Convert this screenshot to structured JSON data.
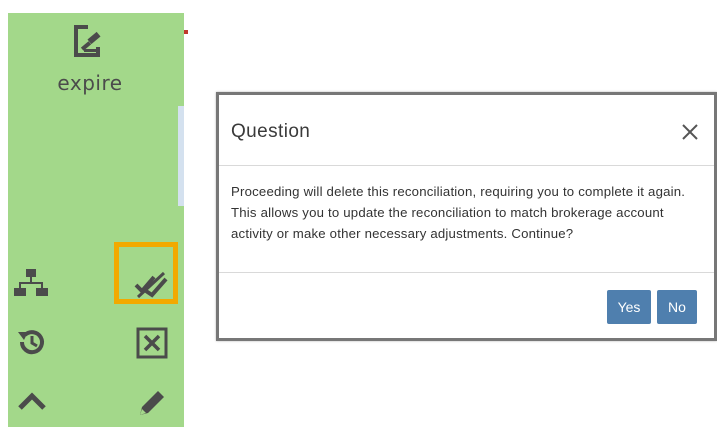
{
  "sidebar": {
    "expire_label": "expire",
    "icons": [
      "gavel-doc-icon",
      "hierarchy-icon",
      "slash-check-icon",
      "history-icon",
      "close-box-icon",
      "chevron-up-icon",
      "pencil-icon"
    ]
  },
  "dialog": {
    "title": "Question",
    "message": "Proceeding will delete this reconciliation, requiring you to complete it again. This allows you to update the reconciliation to match brokerage account activity or make other necessary adjustments. Continue?",
    "yes_label": "Yes",
    "no_label": "No"
  },
  "colors": {
    "sidebar_bg": "#a3d88a",
    "highlight": "#f2a900",
    "button_primary": "#4f7fae"
  }
}
